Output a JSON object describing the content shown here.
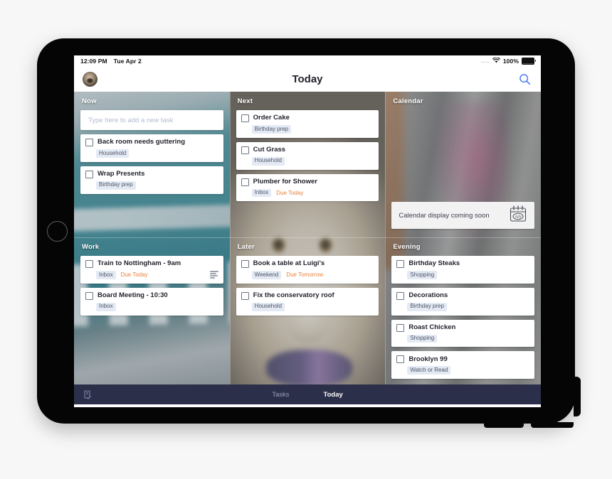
{
  "status_bar": {
    "time": "12:09 PM",
    "date": "Tue Apr 2",
    "dots": "....",
    "battery_percent": "100%"
  },
  "nav": {
    "title": "Today",
    "avatar_name": "user-avatar",
    "search_icon": "search-icon"
  },
  "sections": [
    {
      "id": "now",
      "title": "Now",
      "add_task_placeholder": "Type here to add a new task",
      "tasks": [
        {
          "title": "Back room needs guttering",
          "tag": "Household",
          "due": "",
          "has_notes": false
        },
        {
          "title": "Wrap Presents",
          "tag": "Birthday prep",
          "due": "",
          "has_notes": false
        }
      ]
    },
    {
      "id": "next",
      "title": "Next",
      "tasks": [
        {
          "title": "Order Cake",
          "tag": "Birthday prep",
          "due": "",
          "has_notes": false
        },
        {
          "title": "Cut Grass",
          "tag": "Household",
          "due": "",
          "has_notes": false
        },
        {
          "title": "Plumber for Shower",
          "tag": "Inbox",
          "due": "Due Today",
          "has_notes": false
        }
      ]
    },
    {
      "id": "calendar",
      "title": "Calendar",
      "placeholder_text": "Calendar display coming soon",
      "placeholder_icon": "calendar-icon",
      "calendar_icon_month": "July",
      "tasks": []
    },
    {
      "id": "work",
      "title": "Work",
      "tasks": [
        {
          "title": "Train to Nottingham - 9am",
          "tag": "Inbox",
          "due": "Due Today",
          "has_notes": true
        },
        {
          "title": "Board Meeting - 10:30",
          "tag": "Inbox",
          "due": "",
          "has_notes": false
        }
      ]
    },
    {
      "id": "later",
      "title": "Later",
      "tasks": [
        {
          "title": "Book a table at Luigi's",
          "tag": "Weekend",
          "due": "Due Tomorrow",
          "has_notes": false
        },
        {
          "title": "Fix the conservatory roof",
          "tag": "Household",
          "due": "",
          "has_notes": false
        }
      ]
    },
    {
      "id": "evening",
      "title": "Evening",
      "tasks": [
        {
          "title": "Birthday Steaks",
          "tag": "Shopping",
          "due": "",
          "has_notes": false
        },
        {
          "title": "Decorations",
          "tag": "Birthday prep",
          "due": "",
          "has_notes": false
        },
        {
          "title": "Roast Chicken",
          "tag": "Shopping",
          "due": "",
          "has_notes": false
        },
        {
          "title": "Brooklyn 99",
          "tag": "Watch or Read",
          "due": "",
          "has_notes": false
        }
      ]
    }
  ],
  "tab_bar": {
    "left_icon": "checklist-icon",
    "tabs": [
      {
        "label": "Tasks",
        "active": false
      },
      {
        "label": "Today",
        "active": true
      }
    ]
  },
  "colors": {
    "accent_blue": "#4a7cf0",
    "due_orange": "#e8823c",
    "tag_bg": "#e4eaf4",
    "tabbar_bg": "#2b2f4a",
    "title_dark": "#22242d"
  }
}
